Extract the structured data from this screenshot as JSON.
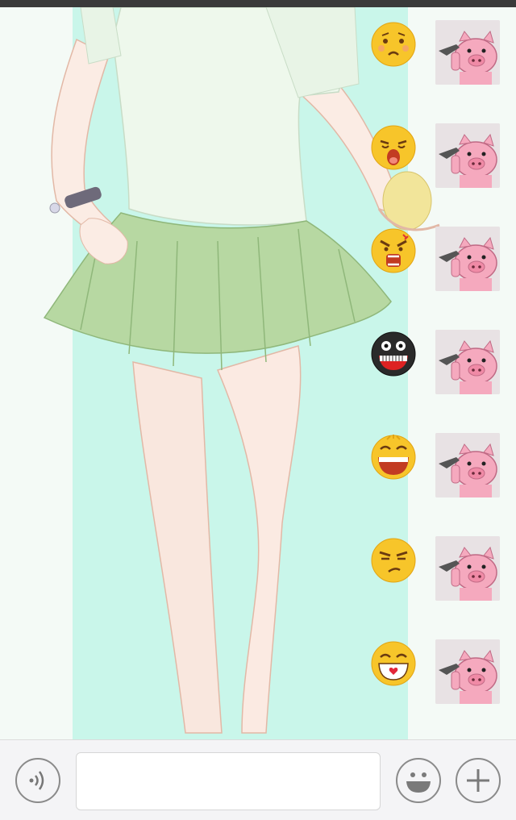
{
  "chat": {
    "messages": [
      {
        "emoji": "worried-face-icon",
        "sticker": "pig-with-gun-sticker"
      },
      {
        "emoji": "crying-face-icon",
        "sticker": "pig-with-gun-sticker"
      },
      {
        "emoji": "angry-shouting-face-icon",
        "sticker": "pig-with-gun-sticker"
      },
      {
        "emoji": "black-grinning-face-icon",
        "sticker": "pig-with-gun-sticker"
      },
      {
        "emoji": "laughing-face-icon",
        "sticker": "pig-with-gun-sticker"
      },
      {
        "emoji": "annoyed-face-icon",
        "sticker": "pig-with-gun-sticker"
      },
      {
        "emoji": "happy-heart-face-icon",
        "sticker": "pig-with-gun-sticker"
      }
    ]
  },
  "input_bar": {
    "text_value": "",
    "placeholder": ""
  },
  "colors": {
    "mint_background": "#c9f6ea",
    "sticker_pig": "#f5a9be",
    "emoji_yellow": "#f7c52a",
    "input_bar": "#f4f4f6"
  }
}
